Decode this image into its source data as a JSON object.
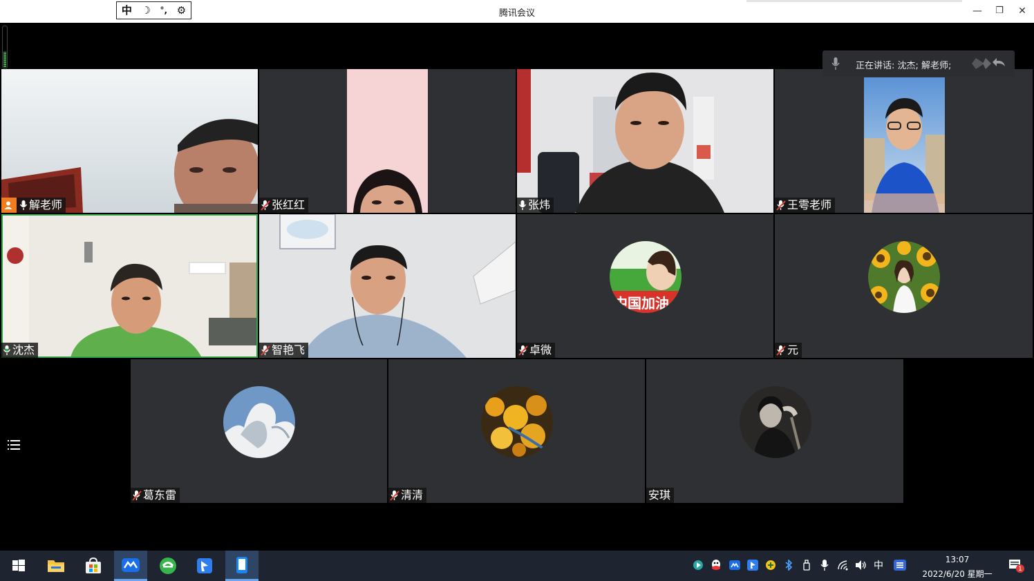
{
  "window": {
    "title": "腾讯会议",
    "minimize": "—",
    "restore": "❐",
    "close": "✕"
  },
  "ime": {
    "mode": "中",
    "moon": "☽",
    "punct": "°,",
    "settings": "⚙"
  },
  "speaking": {
    "text": "正在讲话: 沈杰; 解老师;"
  },
  "participants": [
    {
      "name": "解老师",
      "mic": "on",
      "host": true,
      "video": true
    },
    {
      "name": "张红红",
      "mic": "muted",
      "video": true
    },
    {
      "name": "张炜",
      "mic": "on",
      "video": true
    },
    {
      "name": "王雩老师",
      "mic": "muted",
      "video": true
    },
    {
      "name": "沈杰",
      "mic": "on",
      "video": true,
      "active_speaker": true
    },
    {
      "name": "智艳飞",
      "mic": "muted",
      "video": true
    },
    {
      "name": "卓微",
      "mic": "muted",
      "video": false,
      "avatar_text": "中国加油"
    },
    {
      "name": "元",
      "mic": "muted",
      "video": false
    },
    {
      "name": "葛东雷",
      "mic": "muted",
      "video": false
    },
    {
      "name": "清清",
      "mic": "muted",
      "video": false
    },
    {
      "name": "安琪",
      "mic": "none",
      "video": false
    }
  ],
  "taskbar": {
    "apps": [
      "start-button",
      "file-explorer",
      "store",
      "tencent-meeting",
      "browser",
      "feishu",
      "phone-link"
    ],
    "tray_ime": "中",
    "time": "13:07",
    "date": "2022/6/20 星期一",
    "notification_count": "1"
  },
  "colors": {
    "active_speaker": "#2fa44a",
    "host_badge": "#f07d1f",
    "muted": "#e0453a",
    "tile_bg": "#2f3033"
  }
}
